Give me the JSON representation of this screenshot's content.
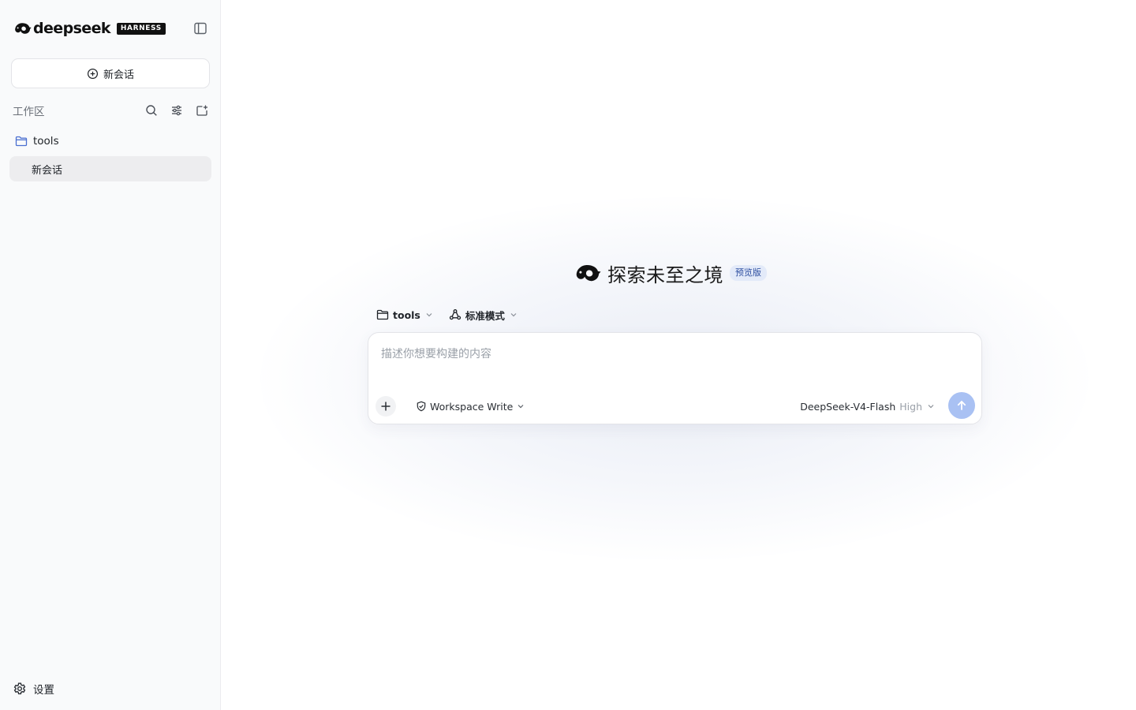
{
  "brand": {
    "name": "deepseek",
    "badge": "HARNESS"
  },
  "sidebar": {
    "new_chat_label": "新会话",
    "workspace_label": "工作区",
    "workspace_tools": [
      "search-icon",
      "filter-icon",
      "new-folder-icon"
    ],
    "folder": {
      "name": "tools",
      "icon": "folder-icon"
    },
    "sessions": [
      {
        "label": "新会话",
        "active": true
      }
    ],
    "settings_label": "设置"
  },
  "hero": {
    "title": "探索未至之境",
    "badge": "预览版"
  },
  "composer": {
    "folder_select": "tools",
    "mode_select": "标准模式",
    "placeholder": "描述你想要构建的内容",
    "value": "",
    "permission": "Workspace Write",
    "model": "DeepSeek-V4-Flash",
    "level": "High"
  },
  "colors": {
    "accent_blue": "#a9c1f3",
    "folder_icon": "#4a6fd0",
    "badge_bg": "#e3eaf9",
    "badge_text": "#2d4ea0"
  }
}
